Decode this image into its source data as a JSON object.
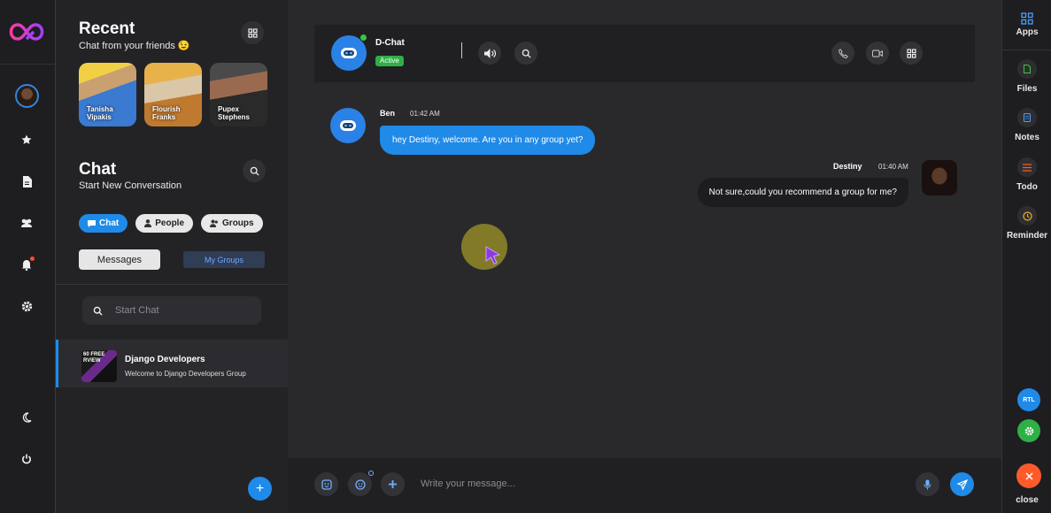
{
  "colors": {
    "accent": "#1f8ae8",
    "online": "#3ec43e",
    "active_badge": "#2eb046",
    "close": "#ff5a2a",
    "settings": "#2eb046"
  },
  "sidebar": {
    "recent_title": "Recent",
    "recent_subtitle": "Chat from your friends 😉",
    "friends": [
      {
        "name": "Tanisha Vipakis"
      },
      {
        "name": "Flourish Franks"
      },
      {
        "name": "Pupex Stephens"
      }
    ],
    "chat_title": "Chat",
    "chat_subtitle": "Start New Conversation",
    "filters": {
      "chat": "Chat",
      "people": "People",
      "groups": "Groups"
    },
    "tabs": {
      "messages": "Messages",
      "my_groups": "My Groups"
    },
    "search_placeholder": "Start Chat",
    "conversations": [
      {
        "title": "Django Developers",
        "subtitle": "Welcome to Django Developers Group",
        "thumb_text": "60 FREE RVIEW"
      }
    ],
    "fab": "+"
  },
  "header": {
    "name": "D-Chat",
    "status": "Active"
  },
  "messages": [
    {
      "author": "Ben",
      "time": "01:42 AM",
      "text": "hey Destiny, welcome. Are you in any group yet?",
      "direction": "in"
    },
    {
      "author": "Destiny",
      "time": "01:40 AM",
      "text": "Not sure,could you recommend a group for me?",
      "direction": "out"
    }
  ],
  "composer": {
    "placeholder": "Write your message..."
  },
  "right_rail": {
    "apps": "Apps",
    "files": "Files",
    "notes": "Notes",
    "todo": "Todo",
    "reminder": "Reminder",
    "rtl": "RTL",
    "close": "close"
  }
}
